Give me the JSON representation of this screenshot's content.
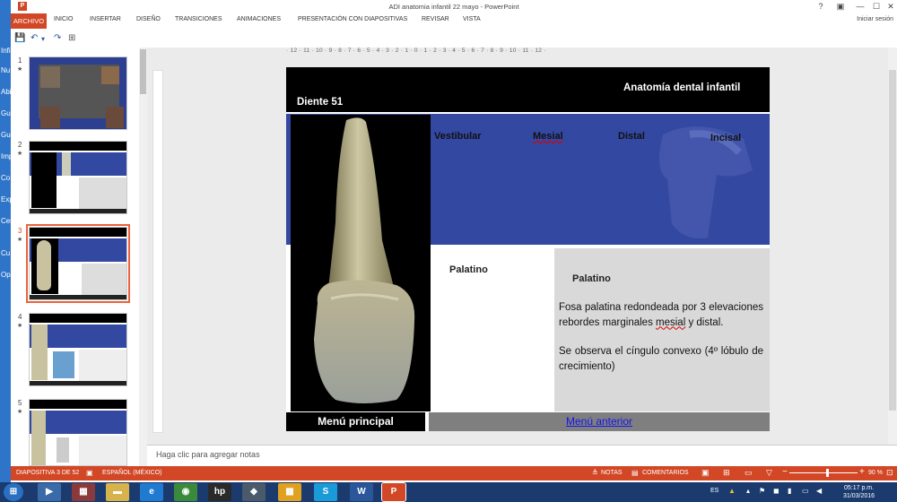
{
  "window": {
    "title": "ADI  anatomia infantil 22 mayo - PowerPoint",
    "app_icon": "P"
  },
  "controls": {
    "help": "?",
    "ribbon_display": "▣",
    "minimize": "—",
    "maximize": "☐",
    "close": "✕"
  },
  "ribbon": {
    "tabs": [
      "ARCHIVO",
      "INICIO",
      "INSERTAR",
      "DISEÑO",
      "TRANSICIONES",
      "ANIMACIONES",
      "PRESENTACIÓN CON DIAPOSITIVAS",
      "REVISAR",
      "VISTA"
    ],
    "signin": "Iniciar sesión"
  },
  "qat": {
    "save": "💾",
    "undo": "↶",
    "dropdown": "▾",
    "redo": "↷",
    "presentation": "⊞"
  },
  "backstage_strip": [
    "Infi",
    "Nu",
    "Abi",
    "Gu",
    "Gu",
    "Imp",
    "Co",
    "Exp",
    "Cer",
    "Cu",
    "Op"
  ],
  "thumbnails": [
    {
      "number": "1"
    },
    {
      "number": "2"
    },
    {
      "number": "3"
    },
    {
      "number": "4"
    },
    {
      "number": "5"
    }
  ],
  "thumb_star": "★",
  "ruler": {
    "h": "· 12 · 11 · 10 · 9 · 8 · 7 · 6 · 5 · 4 · 3 · 2 · 1 · 0 · 1 · 2 · 3 · 4 · 5 · 6 · 7 · 8 · 9 · 10 · 11 · 12 ·"
  },
  "slide": {
    "course": "Anatomía dental  infantil",
    "tooth_title": "Diente 51",
    "views": [
      "Vestibular",
      "Mesial",
      "Distal",
      "Incisal"
    ],
    "palatino_left": "Palatino",
    "palatino_right": "Palatino",
    "desc_part1": "Fosa palatina redondeada por 3 elevaciones rebordes marginales ",
    "desc_mesial": "mesial",
    "desc_part2": " y distal.",
    "desc_cingulo": "Se observa el cíngulo  convexo (4º lóbulo de crecimiento)",
    "menu_principal": "Menú principal",
    "menu_anterior": "Menú anterior"
  },
  "notes": {
    "placeholder": "Haga clic para agregar notas"
  },
  "status": {
    "slide_info": "DIAPOSITIVA 3 DE 52",
    "language": "ESPAÑOL (MÉXICO)",
    "notes_btn": "NOTAS",
    "comments_btn": "COMENTARIOS",
    "zoom": "90 %",
    "zoom_level": 0.55
  },
  "taskbar": {
    "lang": "ES",
    "time": "05:17 p.m.",
    "date": "31/03/2016"
  },
  "colors": {
    "accent": "#d24726",
    "slide_blue": "#3348a0",
    "taskbar": "#1b3b6f"
  }
}
